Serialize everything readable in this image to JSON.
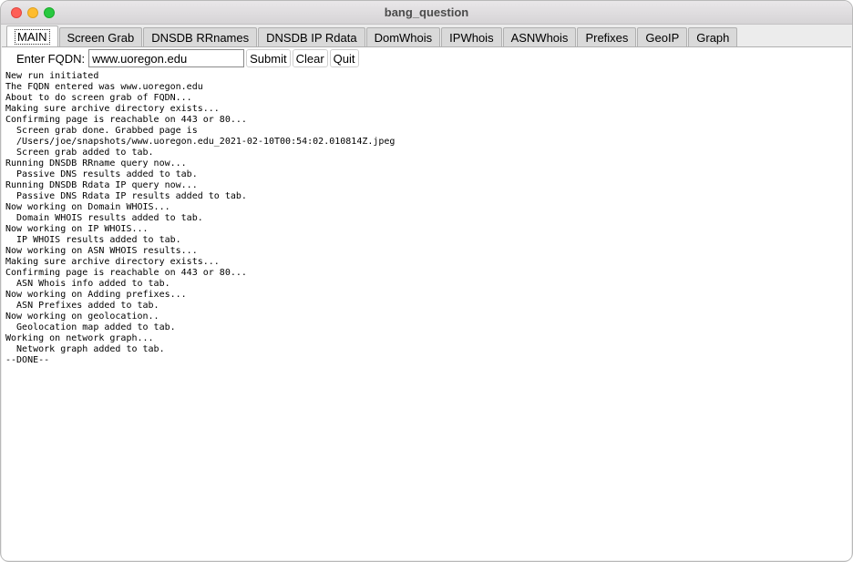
{
  "window": {
    "title": "bang_question"
  },
  "tabs": [
    {
      "label": "MAIN"
    },
    {
      "label": "Screen Grab"
    },
    {
      "label": "DNSDB RRnames"
    },
    {
      "label": "DNSDB IP Rdata"
    },
    {
      "label": "DomWhois"
    },
    {
      "label": "IPWhois"
    },
    {
      "label": "ASNWhois"
    },
    {
      "label": "Prefixes"
    },
    {
      "label": "GeoIP"
    },
    {
      "label": "Graph"
    }
  ],
  "form": {
    "label": "Enter FQDN:",
    "value": "www.uoregon.edu",
    "submit": "Submit",
    "clear": "Clear",
    "quit": "Quit"
  },
  "log": [
    "New run initiated",
    "The FQDN entered was www.uoregon.edu",
    "About to do screen grab of FQDN...",
    "Making sure archive directory exists...",
    "Confirming page is reachable on 443 or 80...",
    "  Screen grab done. Grabbed page is",
    "  /Users/joe/snapshots/www.uoregon.edu_2021-02-10T00:54:02.010814Z.jpeg",
    "  Screen grab added to tab.",
    "Running DNSDB RRname query now...",
    "  Passive DNS results added to tab.",
    "Running DNSDB Rdata IP query now...",
    "  Passive DNS Rdata IP results added to tab.",
    "Now working on Domain WHOIS...",
    "  Domain WHOIS results added to tab.",
    "Now working on IP WHOIS...",
    "  IP WHOIS results added to tab.",
    "Now working on ASN WHOIS results...",
    "Making sure archive directory exists...",
    "Confirming page is reachable on 443 or 80...",
    "  ASN Whois info added to tab.",
    "Now working on Adding prefixes...",
    "  ASN Prefixes added to tab.",
    "Now working on geolocation..",
    "  Geolocation map added to tab.",
    "Working on network graph...",
    "  Network graph added to tab.",
    "--DONE--"
  ]
}
